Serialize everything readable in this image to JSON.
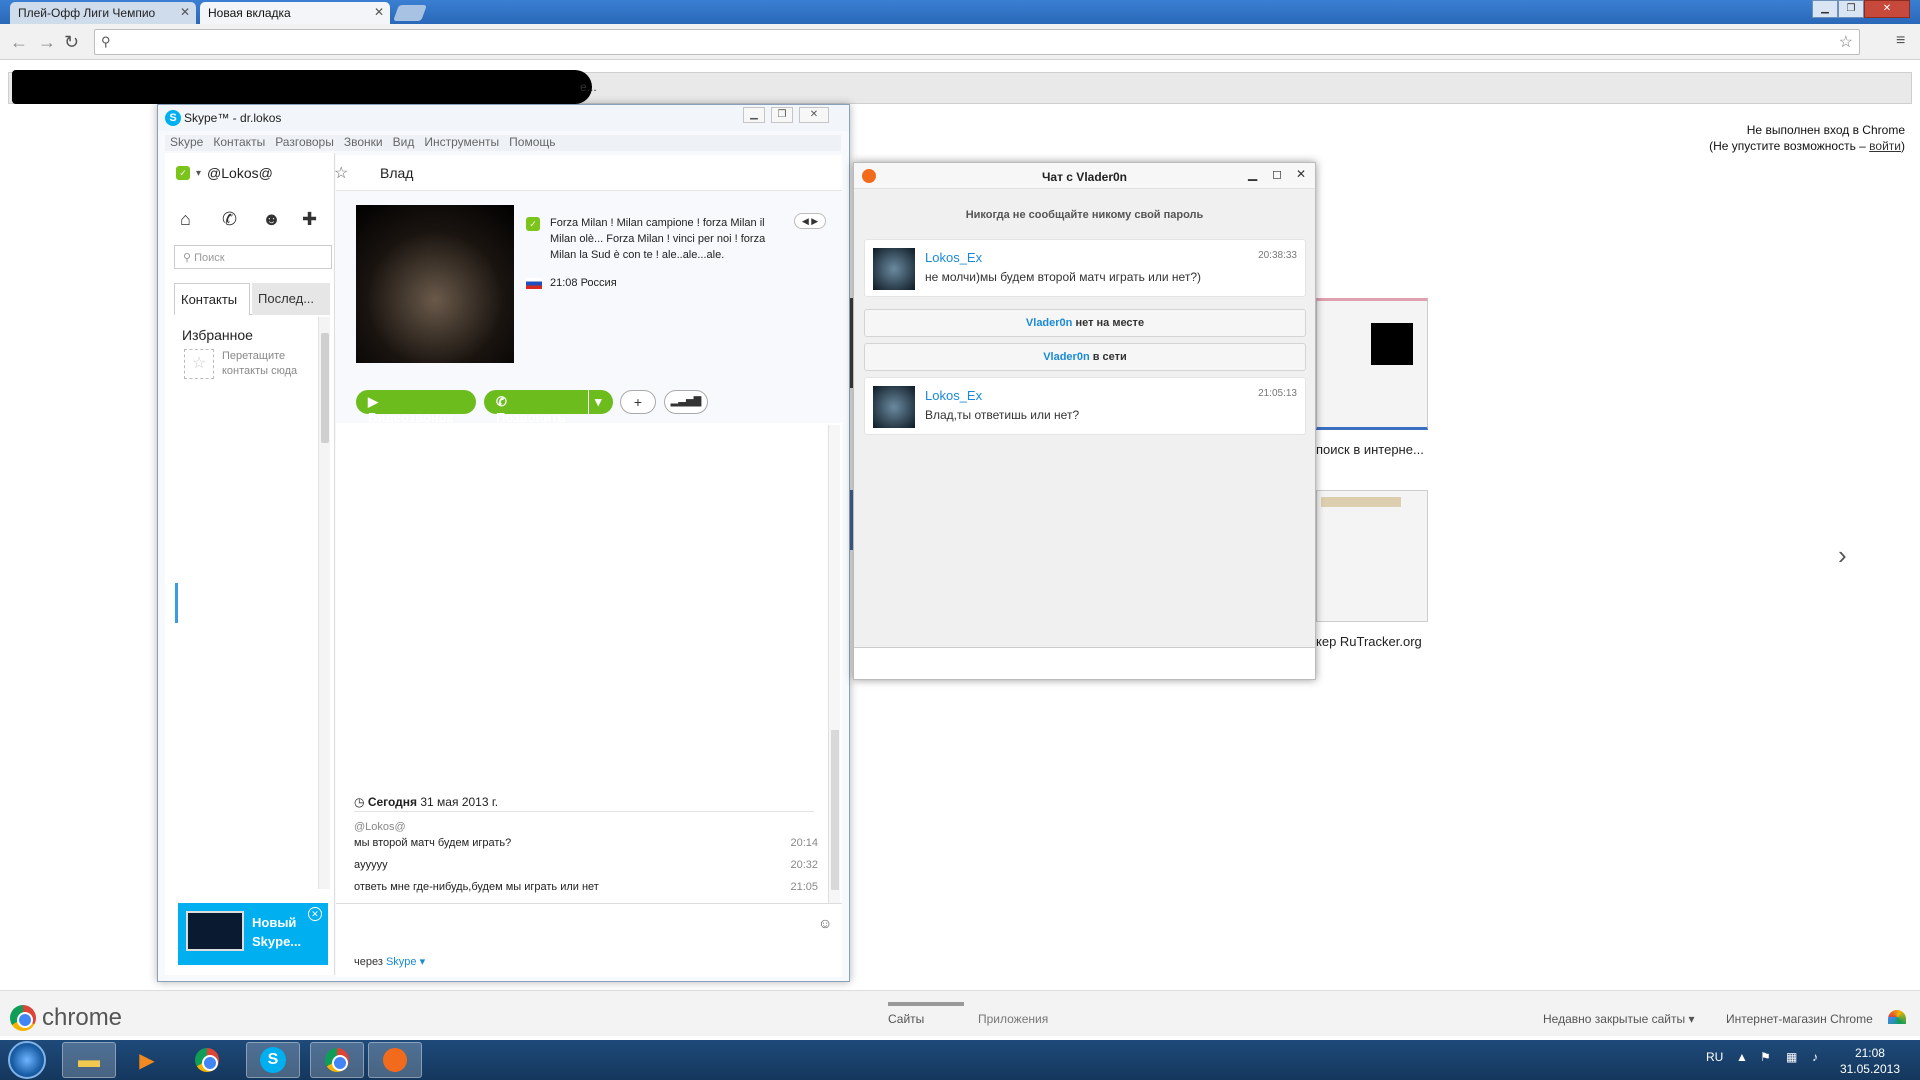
{
  "browser": {
    "tabs": [
      {
        "label": "Плей-Офф Лиги Чемпио"
      },
      {
        "label": "Новая вкладка"
      }
    ],
    "bookmarks_tail": "е...",
    "signin_line1": "Не выполнен вход в Chrome",
    "signin_line2_prefix": "(Не упустите возможность – ",
    "signin_link": "войти",
    "signin_line2_suffix": ")",
    "thumb_labels": [
      "поиск в интерне...",
      "кер RuTracker.org"
    ],
    "chrome_brand": "chrome",
    "bottom_tabs": [
      "Сайты",
      "Приложения"
    ],
    "recent_closed": "Недавно закрытые сайты",
    "webstore": "Интернет-магазин Chrome"
  },
  "skype": {
    "window_title": "Skype™ - dr.lokos",
    "menu": [
      "Skype",
      "Контакты",
      "Разговоры",
      "Звонки",
      "Вид",
      "Инструменты",
      "Помощь"
    ],
    "username": "@Lokos@",
    "search_placeholder": "Поиск",
    "tab_contacts": "Контакты",
    "tab_recent": "Послед...",
    "favorites_header": "Избранное",
    "favorites_hint_1": "Перетащите",
    "favorites_hint_2": "контакты сюда",
    "ad_text_1": "Новый",
    "ad_text_2": "Skype...",
    "contact_name": "Влад",
    "mood_lines": [
      "Forza Milan !  Milan campione !  forza Milan il",
      "Milan olè...  Forza Milan !  vinci per noi !  forza",
      "Milan la Sud è con te !  ale..ale...ale."
    ],
    "location": "21:08 Россия",
    "btn_video": "Видеозвонок",
    "btn_call": "Позвонить",
    "today_label": "Сегодня",
    "today_date": "31 мая 2013 г.",
    "sender": "@Lokos@",
    "messages": [
      {
        "text": "мы второй матч будем играть?",
        "time": "20:14"
      },
      {
        "text": "ayyyyy",
        "time": "20:32"
      },
      {
        "text": "ответь мне где-нибудь,будем мы играть или нет",
        "time": "21:05"
      }
    ],
    "via_prefix": "через",
    "via_link": "Skype"
  },
  "chat": {
    "title": "Чат с Vlader0n",
    "warning": "Никогда не сообщайте никому свой пароль",
    "msg1": {
      "name": "Lokos_Ex",
      "text": "не молчи)мы будем второй матч играть или нет?)",
      "time": "20:38:33"
    },
    "sys1_name": "Vlader0n",
    "sys1_text": " нет на месте",
    "sys2_name": "Vlader0n",
    "sys2_text": " в сети",
    "msg2": {
      "name": "Lokos_Ex",
      "text": "Влад,ты ответишь или нет?",
      "time": "21:05:13"
    }
  },
  "taskbar": {
    "lang": "RU",
    "time": "21:08",
    "date": "31.05.2013"
  },
  "colors": {
    "skype_blue": "#00aff0",
    "skype_green": "#6cbc1e",
    "link_blue": "#1a8ad6"
  }
}
